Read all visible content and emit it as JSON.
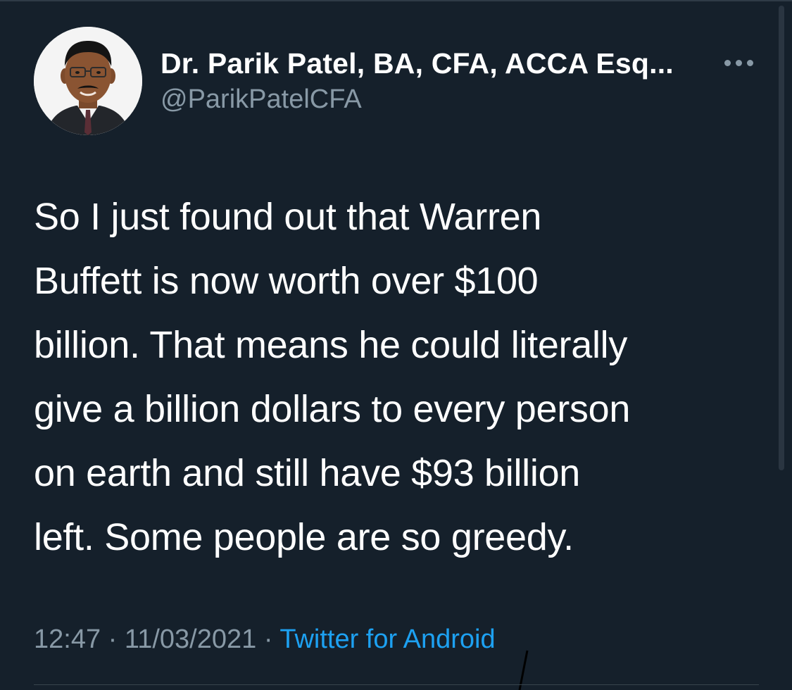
{
  "tweet": {
    "display_name": "Dr. Parik Patel, BA, CFA, ACCA Esq...",
    "handle": "@ParikPatelCFA",
    "more_icon": "more-horizontal-icon",
    "text_lines": [
      "So I just found out that Warren",
      "Buffett is now worth over $100",
      "billion. That means he could literally",
      "give a billion dollars to every person",
      "on earth and still have $93 billion",
      "left. Some people are so greedy."
    ],
    "time": "12:47",
    "separator": "·",
    "date": "11/03/2021",
    "source": "Twitter for Android"
  },
  "colors": {
    "background": "#15202b",
    "primary_text": "#ffffff",
    "secondary_text": "#8899a6",
    "link": "#1da1f2",
    "divider": "#38444d"
  }
}
